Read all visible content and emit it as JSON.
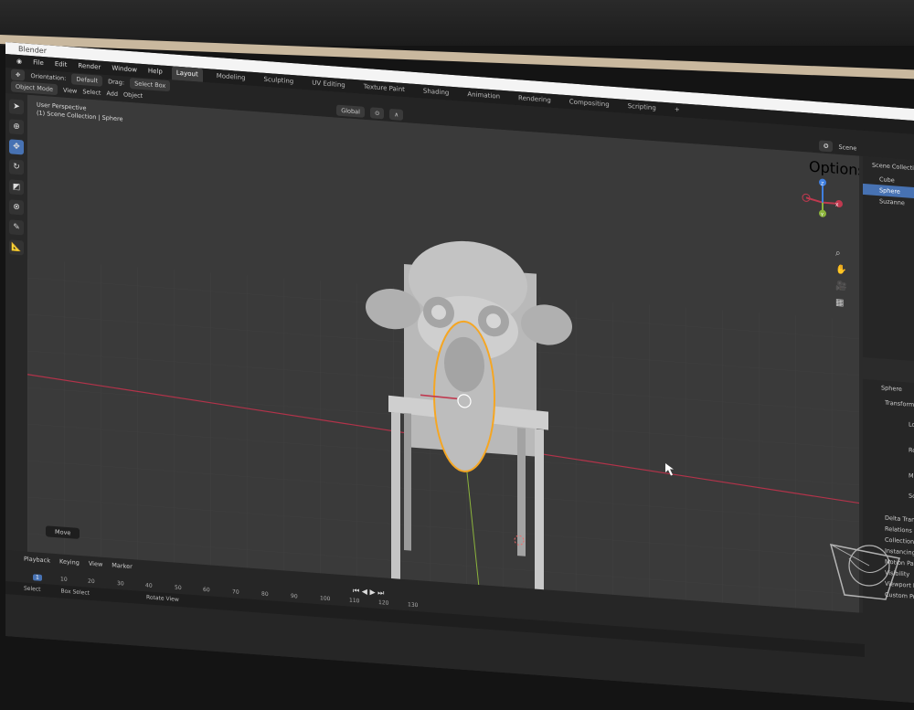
{
  "window": {
    "title": "Blender"
  },
  "menu": [
    "File",
    "Edit",
    "Render",
    "Window",
    "Help"
  ],
  "workspace_tabs": [
    {
      "label": "Layout",
      "active": true
    },
    {
      "label": "Modeling"
    },
    {
      "label": "Sculpting"
    },
    {
      "label": "UV Editing"
    },
    {
      "label": "Texture Paint"
    },
    {
      "label": "Shading"
    },
    {
      "label": "Animation"
    },
    {
      "label": "Rendering"
    },
    {
      "label": "Compositing"
    },
    {
      "label": "Scripting"
    }
  ],
  "add_workspace": "+",
  "header": {
    "orientation_label": "Orientation:",
    "orientation_value": "Default",
    "drag_label": "Drag:",
    "drag_value": "Select Box",
    "mode": "Object Mode",
    "menus": [
      "View",
      "Select",
      "Add",
      "Object"
    ],
    "transform_orientation": "Global",
    "options": "Options"
  },
  "viewport": {
    "perspective": "User Perspective",
    "collection": "(1) Scene Collection | Sphere",
    "gizmo_axes": [
      "X",
      "Y",
      "Z"
    ]
  },
  "scene_label": "Scene",
  "outliner": {
    "title": "Scene Collection",
    "items": [
      "Cube",
      "Sphere",
      "Suzanne"
    ],
    "selected": "Sphere"
  },
  "properties": {
    "object_name": "Sphere",
    "sections": [
      "Transform",
      "Delta Transform",
      "Relations",
      "Collections",
      "Instancing",
      "Motion Paths",
      "Visibility",
      "Viewport Display",
      "Custom Properties"
    ],
    "fields": [
      "Location",
      "Rotation",
      "Mode",
      "Scale"
    ]
  },
  "operator_panel": "Move",
  "timeline": {
    "menus": [
      "Playback",
      "Keying",
      "View",
      "Marker"
    ],
    "frames": [
      "0",
      "10",
      "20",
      "30",
      "40",
      "50",
      "60",
      "70",
      "80",
      "90",
      "100",
      "110",
      "120",
      "130"
    ],
    "current_frame": "1"
  },
  "statusbar": {
    "items": [
      "Select",
      "Box Select",
      "Rotate View"
    ]
  },
  "colors": {
    "accent": "#4772b3",
    "selection": "#f5a623",
    "x_axis": "#c0394f",
    "y_axis": "#8cb43c",
    "z_axis": "#3f7fe0"
  }
}
